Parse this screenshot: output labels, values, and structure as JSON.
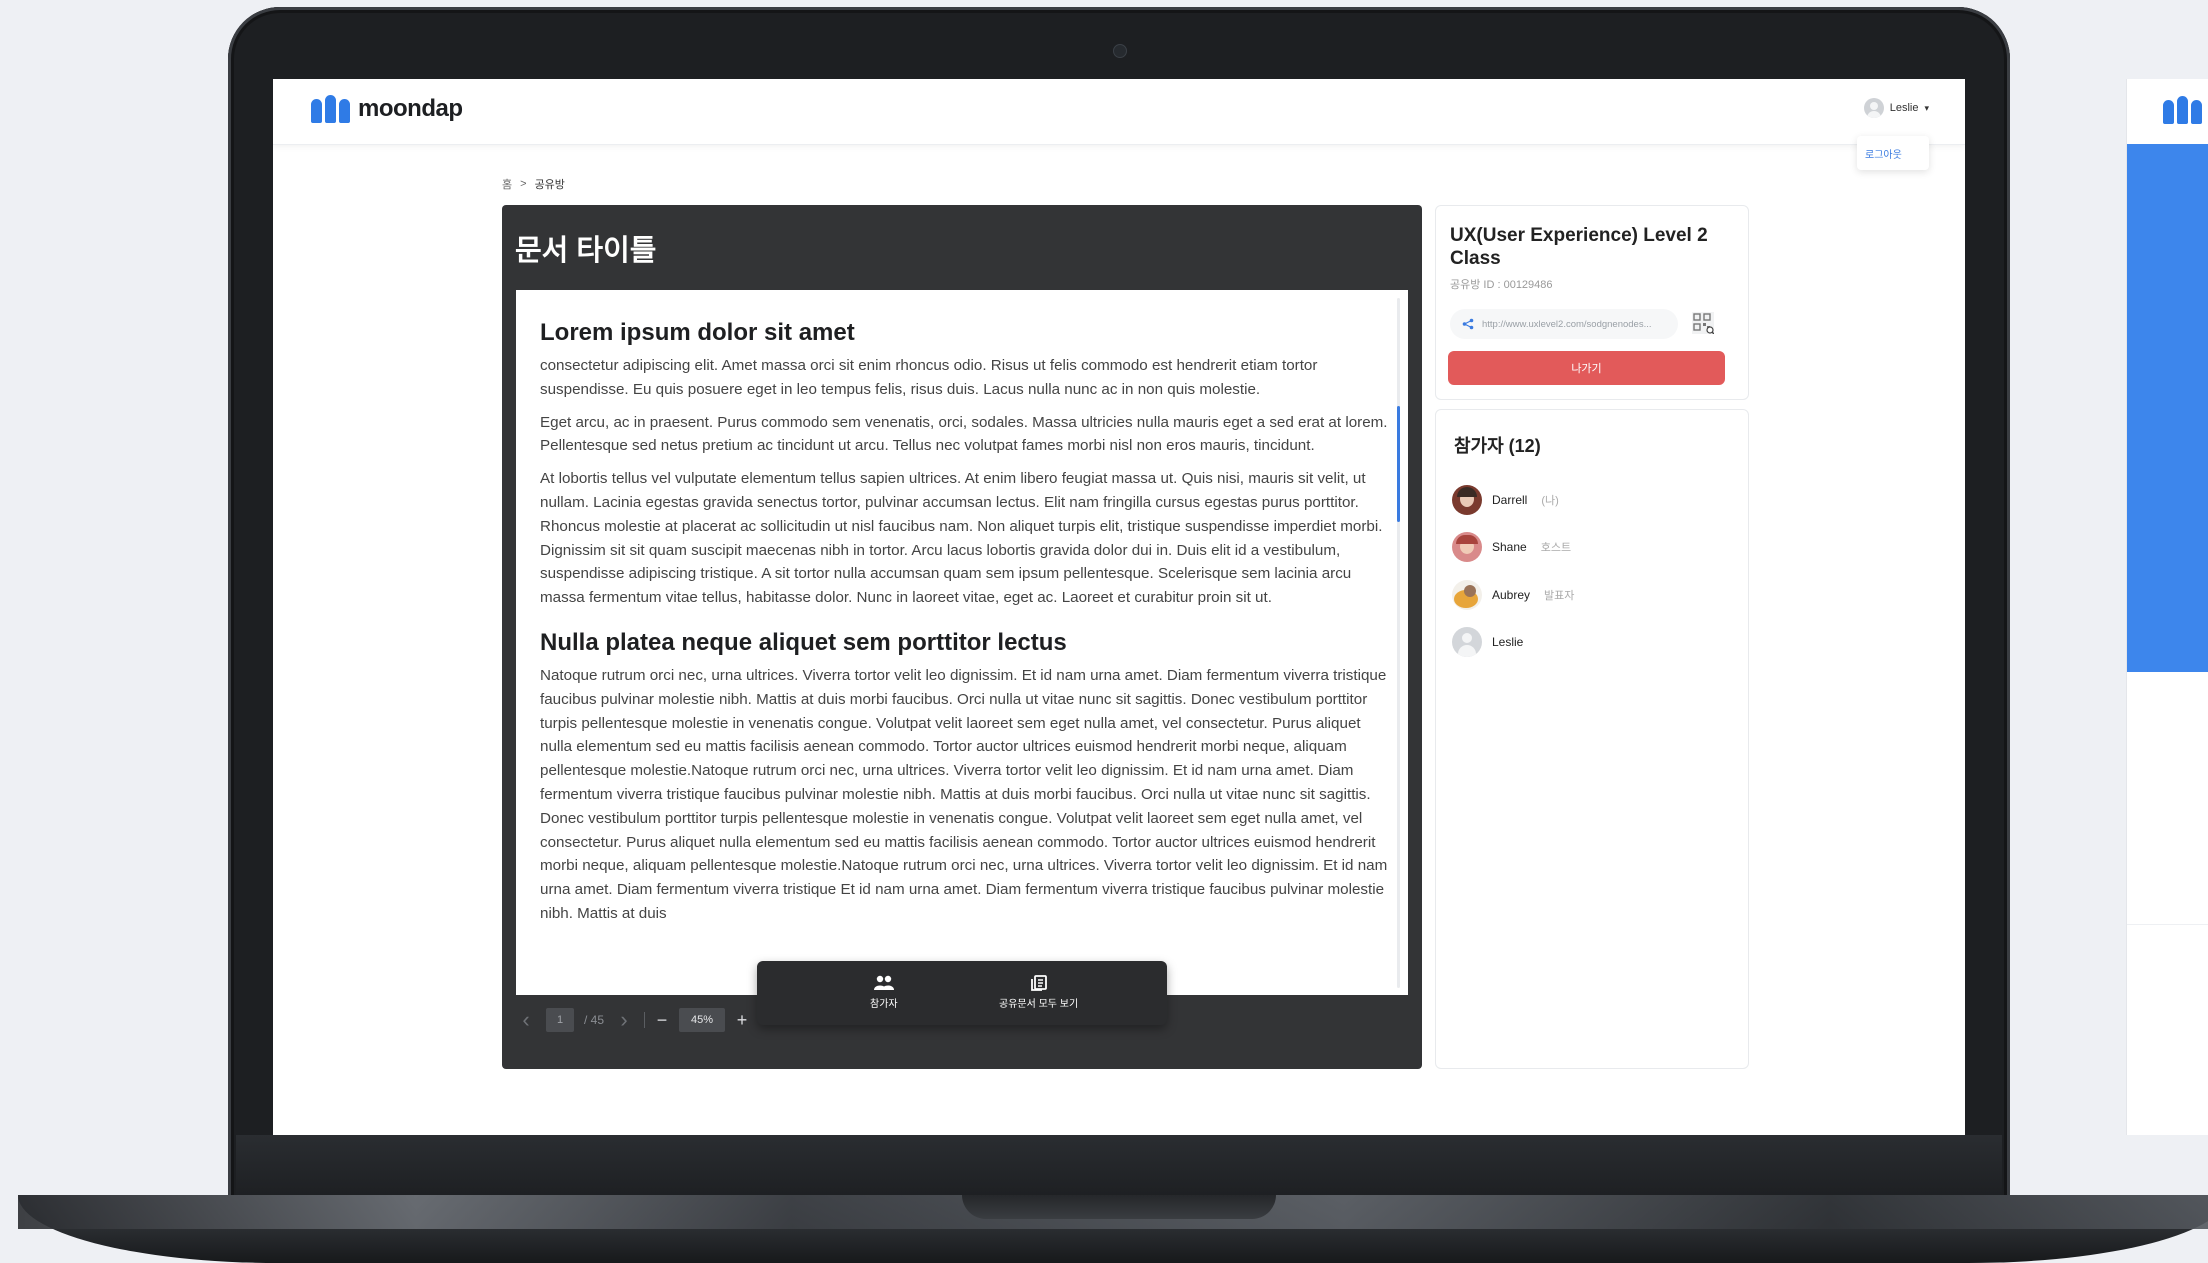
{
  "app": {
    "logo_text": "moondap",
    "brand_color": "#2f7be6"
  },
  "user_menu": {
    "name": "Leslie",
    "logout": "로그아웃"
  },
  "breadcrumb": {
    "home": "홈",
    "separator": ">",
    "current": "공유방"
  },
  "document": {
    "title": "문서 타이틀",
    "heading1": "Lorem ipsum dolor sit amet",
    "para1": "consectetur adipiscing elit. Amet massa orci sit enim rhoncus odio. Risus ut felis commodo est hendrerit etiam tortor suspendisse. Eu quis posuere eget in leo tempus felis, risus duis. Lacus nulla nunc ac in non quis molestie.",
    "para2": "Eget arcu, ac in praesent. Purus commodo sem venenatis, orci, sodales. Massa ultricies nulla mauris eget a sed erat at lorem. Pellentesque sed netus pretium ac tincidunt ut arcu. Tellus nec volutpat fames morbi nisl non eros mauris, tincidunt.",
    "para3": "At lobortis tellus vel vulputate elementum tellus sapien ultrices. At enim libero feugiat massa ut. Quis nisi, mauris sit velit, ut nullam. Lacinia egestas gravida senectus tortor, pulvinar accumsan lectus. Elit nam fringilla cursus egestas purus porttitor. Rhoncus molestie at placerat ac sollicitudin ut nisl faucibus nam. Non aliquet turpis elit, tristique suspendisse imperdiet morbi. Dignissim sit sit quam suscipit maecenas nibh in tortor. Arcu lacus lobortis gravida dolor dui in. Duis elit id a vestibulum, suspendisse adipiscing tristique. A sit tortor nulla accumsan quam sem ipsum pellentesque. Scelerisque sem lacinia arcu massa fermentum vitae tellus, habitasse dolor. Nunc in laoreet vitae, eget ac. Laoreet et curabitur proin sit ut.",
    "heading2": "Nulla platea neque aliquet sem porttitor lectus",
    "para4": "Natoque rutrum orci nec, urna ultrices. Viverra tortor velit leo dignissim. Et id nam urna amet. Diam fermentum viverra tristique faucibus pulvinar molestie nibh. Mattis at duis morbi faucibus. Orci nulla ut vitae nunc sit sagittis. Donec vestibulum porttitor turpis pellentesque molestie in venenatis congue. Volutpat velit laoreet sem eget nulla amet, vel consectetur. Purus aliquet nulla elementum sed eu mattis facilisis aenean commodo. Tortor auctor ultrices euismod hendrerit morbi neque, aliquam pellentesque molestie.Natoque rutrum orci nec, urna ultrices. Viverra tortor velit leo dignissim. Et id nam urna amet. Diam fermentum viverra tristique faucibus pulvinar molestie nibh. Mattis at duis morbi faucibus. Orci nulla ut vitae nunc sit sagittis. Donec vestibulum porttitor turpis pellentesque molestie in venenatis congue. Volutpat velit laoreet sem eget nulla amet, vel consectetur. Purus aliquet nulla elementum sed eu mattis facilisis aenean commodo. Tortor auctor ultrices euismod hendrerit morbi neque, aliquam pellentesque molestie.Natoque rutrum orci nec, urna ultrices. Viverra tortor velit leo dignissim. Et id nam urna amet. Diam fermentum viverra tristique Et id nam urna amet. Diam fermentum viverra tristique faucibus pulvinar molestie nibh. Mattis at duis"
  },
  "pager": {
    "current_page": "1",
    "total": "/ 45",
    "zoom": "45%",
    "zoom_out": "−",
    "zoom_in": "+"
  },
  "action_bar": {
    "participants": "참가자",
    "view_all_docs": "공유문서 모두 보기"
  },
  "room": {
    "title": "UX(User Experience) Level 2 Class",
    "id_label": "공유방 ID : 00129486",
    "link": "http://www.uxlevel2.com/sodgnenodes...",
    "leave_button": "나가기",
    "leave_color": "#e25a5a"
  },
  "participants": {
    "title": "참가자 (12)",
    "items": [
      {
        "name": "Darrell",
        "role": "(나)"
      },
      {
        "name": "Shane",
        "role": "호스트"
      },
      {
        "name": "Aubrey",
        "role": "발표자"
      },
      {
        "name": "Leslie",
        "role": ""
      }
    ]
  }
}
